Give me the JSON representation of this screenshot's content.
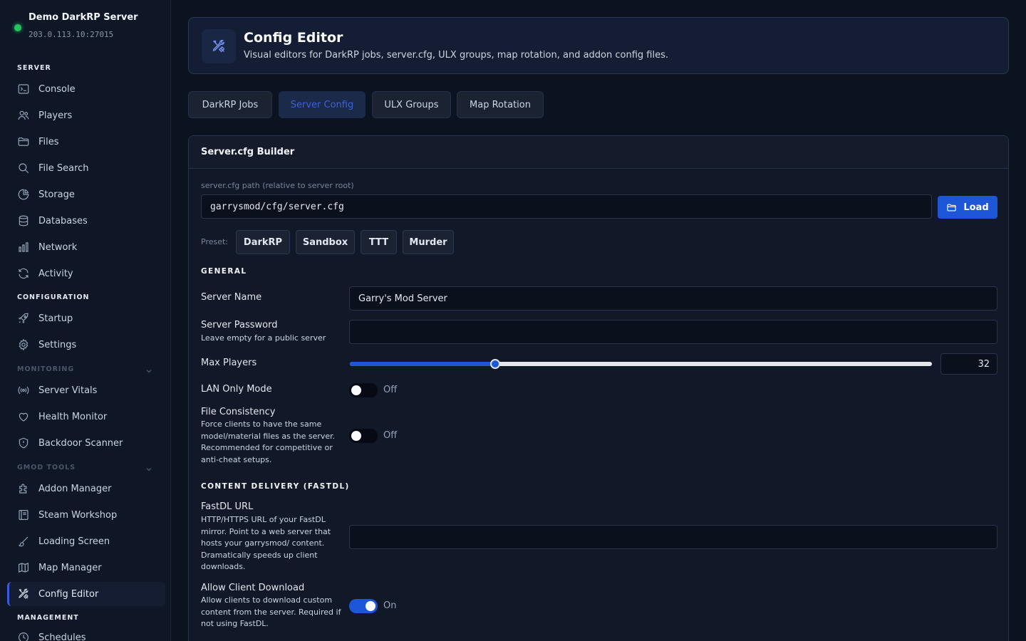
{
  "server": {
    "name": "Demo DarkRP Server",
    "address": "203.0.113.10:27015",
    "status_color": "#22c55e"
  },
  "sidebar": {
    "sections": {
      "server": "SERVER",
      "configuration": "CONFIGURATION",
      "monitoring": "MONITORING",
      "gmod_tools": "GMOD TOOLS",
      "management": "MANAGEMENT"
    },
    "items": [
      {
        "label": "Console",
        "icon": "terminal-icon"
      },
      {
        "label": "Players",
        "icon": "users-icon"
      },
      {
        "label": "Files",
        "icon": "folder-icon"
      },
      {
        "label": "File Search",
        "icon": "search-icon"
      },
      {
        "label": "Storage",
        "icon": "pie-chart-icon"
      },
      {
        "label": "Databases",
        "icon": "database-icon"
      },
      {
        "label": "Network",
        "icon": "bar-chart-icon"
      },
      {
        "label": "Activity",
        "icon": "refresh-icon"
      },
      {
        "label": "Startup",
        "icon": "rocket-icon"
      },
      {
        "label": "Settings",
        "icon": "gear-icon"
      },
      {
        "label": "Server Vitals",
        "icon": "broadcast-icon"
      },
      {
        "label": "Health Monitor",
        "icon": "heart-icon"
      },
      {
        "label": "Backdoor Scanner",
        "icon": "shield-icon"
      },
      {
        "label": "Addon Manager",
        "icon": "puzzle-icon"
      },
      {
        "label": "Steam Workshop",
        "icon": "book-icon"
      },
      {
        "label": "Loading Screen",
        "icon": "brush-icon"
      },
      {
        "label": "Map Manager",
        "icon": "map-icon"
      },
      {
        "label": "Config Editor",
        "icon": "tools-icon"
      },
      {
        "label": "Schedules",
        "icon": "clock-icon"
      }
    ],
    "active_item": "Config Editor"
  },
  "header": {
    "title": "Config Editor",
    "subtitle": "Visual editors for DarkRP jobs, server.cfg, ULX groups, map rotation, and addon config files."
  },
  "tabs": [
    {
      "label": "DarkRP Jobs"
    },
    {
      "label": "Server Config",
      "active": true
    },
    {
      "label": "ULX Groups"
    },
    {
      "label": "Map Rotation"
    }
  ],
  "builder": {
    "title": "Server.cfg Builder",
    "path_label": "server.cfg path (relative to server root)",
    "path_value": "garrysmod/cfg/server.cfg",
    "load_label": "Load",
    "preset_label": "Preset:",
    "presets": [
      "DarkRP",
      "Sandbox",
      "TTT",
      "Murder"
    ],
    "general_heading": "GENERAL",
    "server_name": {
      "label": "Server Name",
      "value": "Garry's Mod Server"
    },
    "server_password": {
      "label": "Server Password",
      "help": "Leave empty for a public server",
      "value": ""
    },
    "max_players": {
      "label": "Max Players",
      "value": 32,
      "fraction": 0.25
    },
    "lan_only": {
      "label": "LAN Only Mode",
      "state": "Off",
      "on": false
    },
    "file_consistency": {
      "label": "File Consistency",
      "help": "Force clients to have the same model/material files as the server. Recommended for competitive or anti-cheat setups.",
      "state": "Off",
      "on": false
    },
    "fastdl_heading": "CONTENT DELIVERY (FASTDL)",
    "fastdl_url": {
      "label": "FastDL URL",
      "help": "HTTP/HTTPS URL of your FastDL mirror. Point to a web server that hosts your garrysmod/ content. Dramatically speeds up client downloads.",
      "value": ""
    },
    "allow_download": {
      "label": "Allow Client Download",
      "help": "Allow clients to download custom content from the server. Required if not using FastDL.",
      "state": "On",
      "on": true
    }
  },
  "colors": {
    "accent": "#1e56d8",
    "background": "#0b1220",
    "panel": "#111827"
  }
}
